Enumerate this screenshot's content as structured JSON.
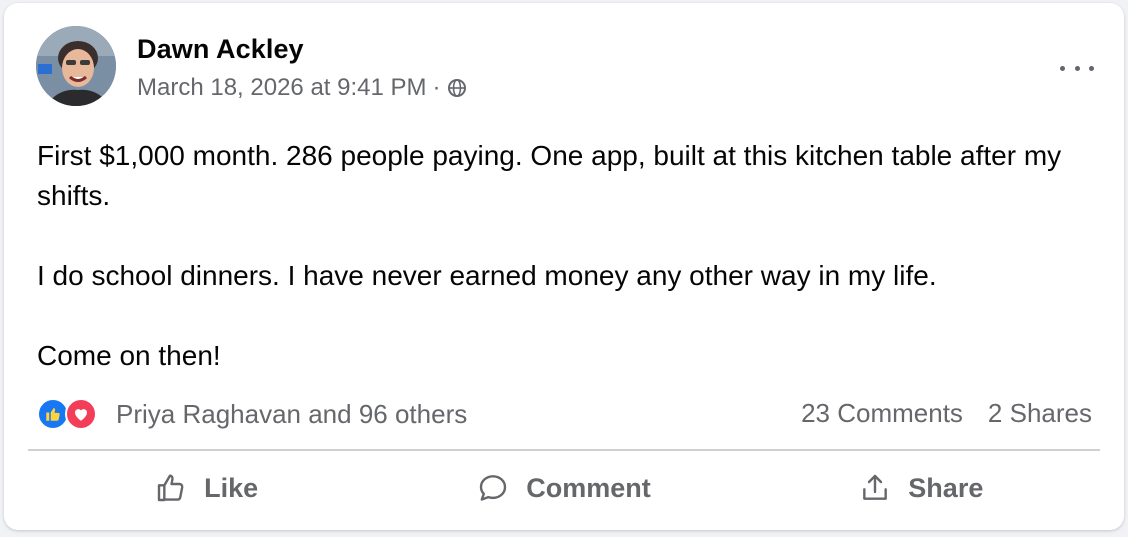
{
  "post": {
    "author": "Dawn Ackley",
    "timestamp": "March 18, 2026 at 9:41 PM",
    "separator": "·",
    "audience_icon": "globe-icon",
    "more_icon": "more-options-icon",
    "text": [
      "First $1,000 month. 286 people paying. One app, built at this kitchen table after my shifts.",
      "I do school dinners. I have never earned money any other way in my life.",
      "Come on then!"
    ]
  },
  "reactions": {
    "icons": [
      "like-reaction-icon",
      "love-reaction-icon"
    ],
    "summary": "Priya Raghavan and 96 others",
    "comments": "23 Comments",
    "shares": "2 Shares"
  },
  "actions": [
    {
      "label": "Like",
      "icon": "thumbs-up-icon"
    },
    {
      "label": "Comment",
      "icon": "comment-bubble-icon"
    },
    {
      "label": "Share",
      "icon": "share-icon"
    }
  ],
  "colors": {
    "like_blue": "#1877f2",
    "love_red": "#f33e58",
    "secondary_text": "#65676b",
    "primary_text": "#050505"
  }
}
